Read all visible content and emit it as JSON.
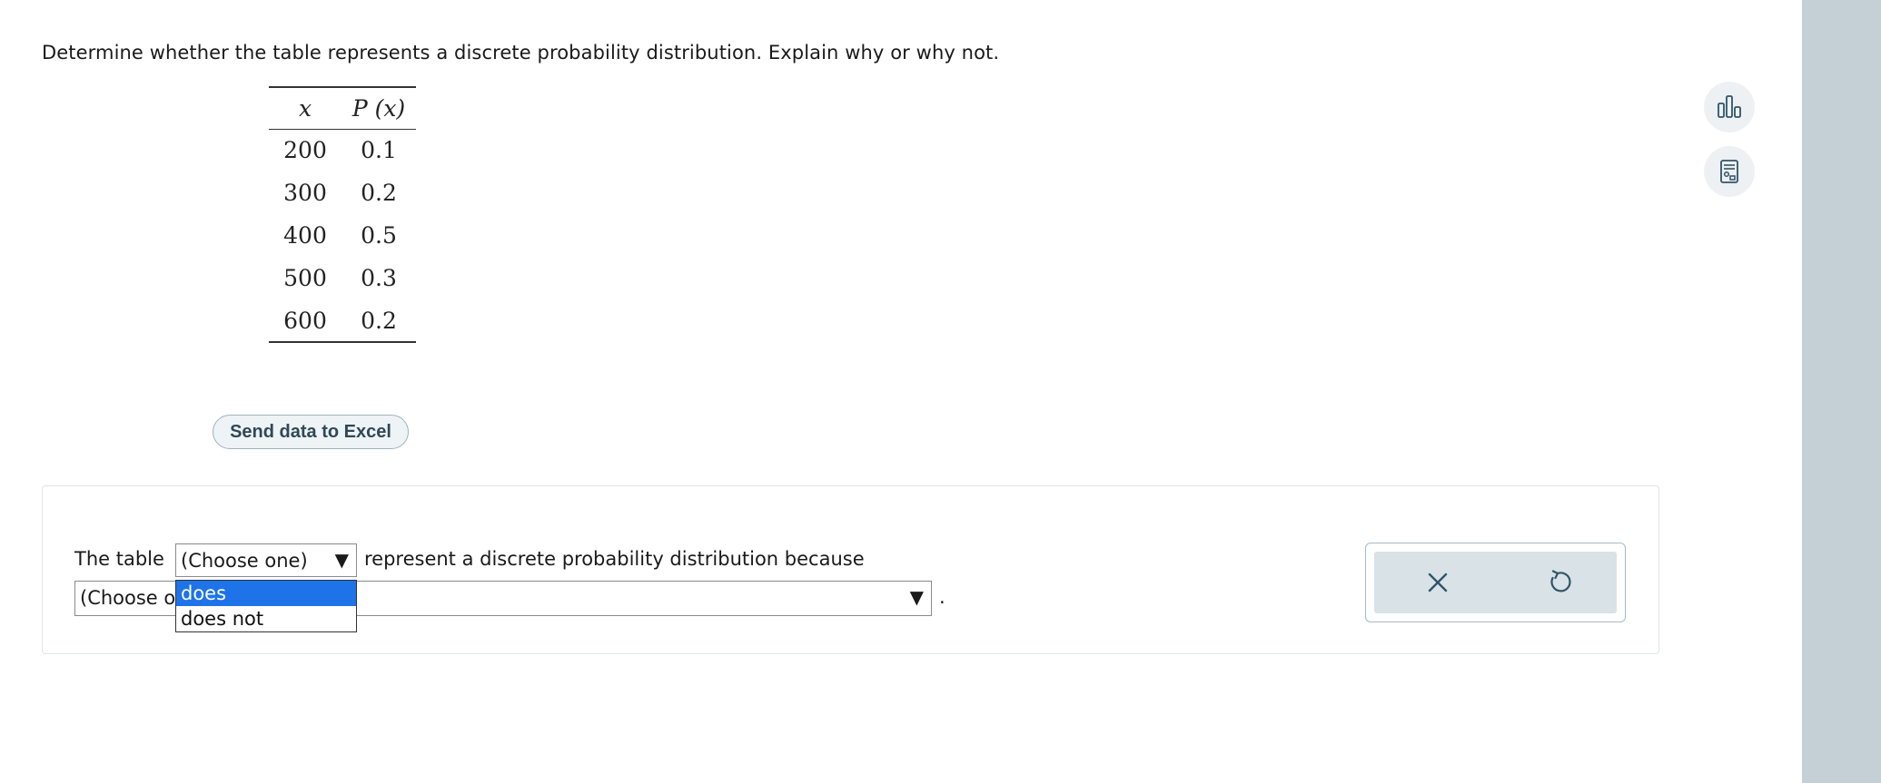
{
  "question": "Determine whether the table represents a discrete probability distribution. Explain why or why not.",
  "table": {
    "headers": [
      "x",
      "P (x)"
    ],
    "rows": [
      [
        "200",
        "0.1"
      ],
      [
        "300",
        "0.2"
      ],
      [
        "400",
        "0.5"
      ],
      [
        "500",
        "0.3"
      ],
      [
        "600",
        "0.2"
      ]
    ]
  },
  "excel_button_label": "Send data to Excel",
  "answer": {
    "prefix": "The table",
    "first_select": {
      "value": "(Choose one)",
      "arrow": "▼"
    },
    "middle_text": "represent a discrete probability distribution because",
    "second_select": {
      "value": "(Choose one)",
      "arrow": "▼"
    },
    "period": ".",
    "dropdown_options": [
      "does",
      "does not"
    ],
    "highlighted_option": "does"
  },
  "actions": {
    "clear_icon": "close-icon",
    "undo_icon": "undo-icon"
  },
  "side_tools": [
    "bar-chart-icon",
    "calculator-icon"
  ],
  "colors": {
    "highlight": "#1e73e8",
    "right_rail": "#c4d0d6",
    "action_bg": "#d8e2e7",
    "icon": "#2f5468"
  }
}
